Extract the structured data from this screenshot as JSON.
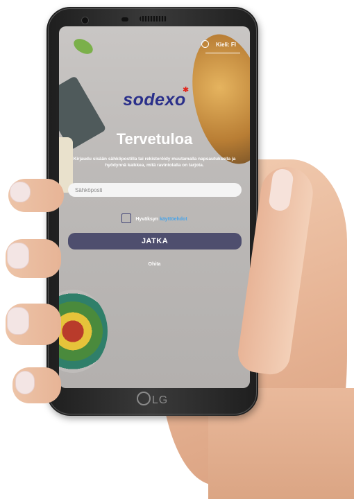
{
  "device": {
    "brand_label": "LG"
  },
  "language": {
    "label": "Kieli: FI"
  },
  "brand": {
    "logo_text": "sodexo"
  },
  "welcome": {
    "title": "Tervetuloa",
    "subtitle": "Kirjaudu sisään sähköpostilla tai rekisteröidy muutamalla napsautuksella ja hyödynnä kaikkea, mitä ravintolalla on tarjota."
  },
  "form": {
    "email_placeholder": "Sähköposti",
    "email_value": "",
    "accept_text": "Hyväksyn",
    "terms_link": "käyttöehdot",
    "accept_checked": false,
    "continue_label": "JATKA",
    "skip_label": "Ohita"
  },
  "colors": {
    "brand_blue": "#2a2f8a",
    "brand_red_star": "#e2231a",
    "button_bg": "#4e4e6e",
    "link": "#4aa4e8"
  }
}
